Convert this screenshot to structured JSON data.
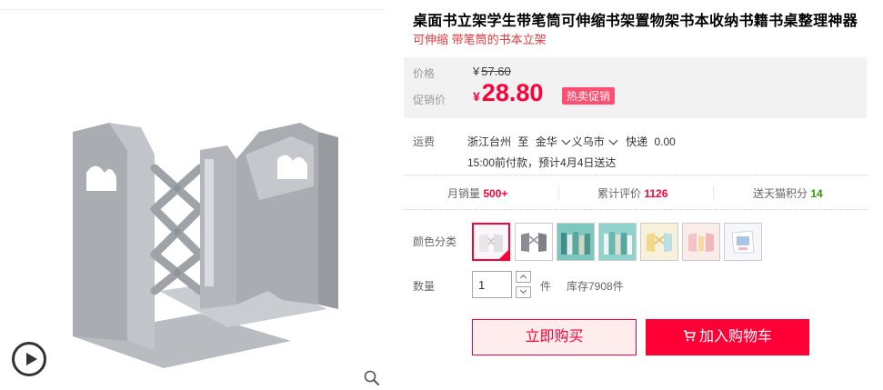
{
  "product": {
    "title": "桌面书立架学生带笔筒可伸缩书架置物架书本收纳书籍书桌整理神器",
    "subtitle": "可伸缩 带笔筒的书本立架"
  },
  "price": {
    "original_label": "价格",
    "currency": "¥",
    "original_value": "57.60",
    "promo_label": "促销价",
    "promo_value": "28.80",
    "promo_badge": "热卖促销"
  },
  "shipping": {
    "label": "运费",
    "from": "浙江台州",
    "to_word": "至",
    "province": "金华",
    "city": "义乌市",
    "method": "快递",
    "fee": "0.00",
    "eta": "15:00前付款，预计4月4日送达"
  },
  "stats": {
    "monthly_sales_label": "月销量",
    "monthly_sales_value": "500+",
    "reviews_label": "累计评价",
    "reviews_value": "1126",
    "points_label": "送天猫积分",
    "points_value": "14"
  },
  "options": {
    "color_label": "颜色分类",
    "swatches": [
      {
        "name": "white-stand",
        "selected": true
      },
      {
        "name": "gray-stand",
        "selected": false
      },
      {
        "name": "green-books",
        "selected": false
      },
      {
        "name": "teal-books",
        "selected": false
      },
      {
        "name": "yellow-stand",
        "selected": false
      },
      {
        "name": "pink-stand",
        "selected": false
      },
      {
        "name": "blue-stand",
        "selected": false
      }
    ]
  },
  "quantity": {
    "label": "数量",
    "value": "1",
    "unit": "件",
    "stock": "库存7908件"
  },
  "actions": {
    "buy_now": "立即购买",
    "add_to_cart": "加入购物车"
  },
  "colors": {
    "accent": "#ff0036",
    "price_bg": "#f2f2f2",
    "subtitle": "#e4393c",
    "green": "#339900"
  }
}
